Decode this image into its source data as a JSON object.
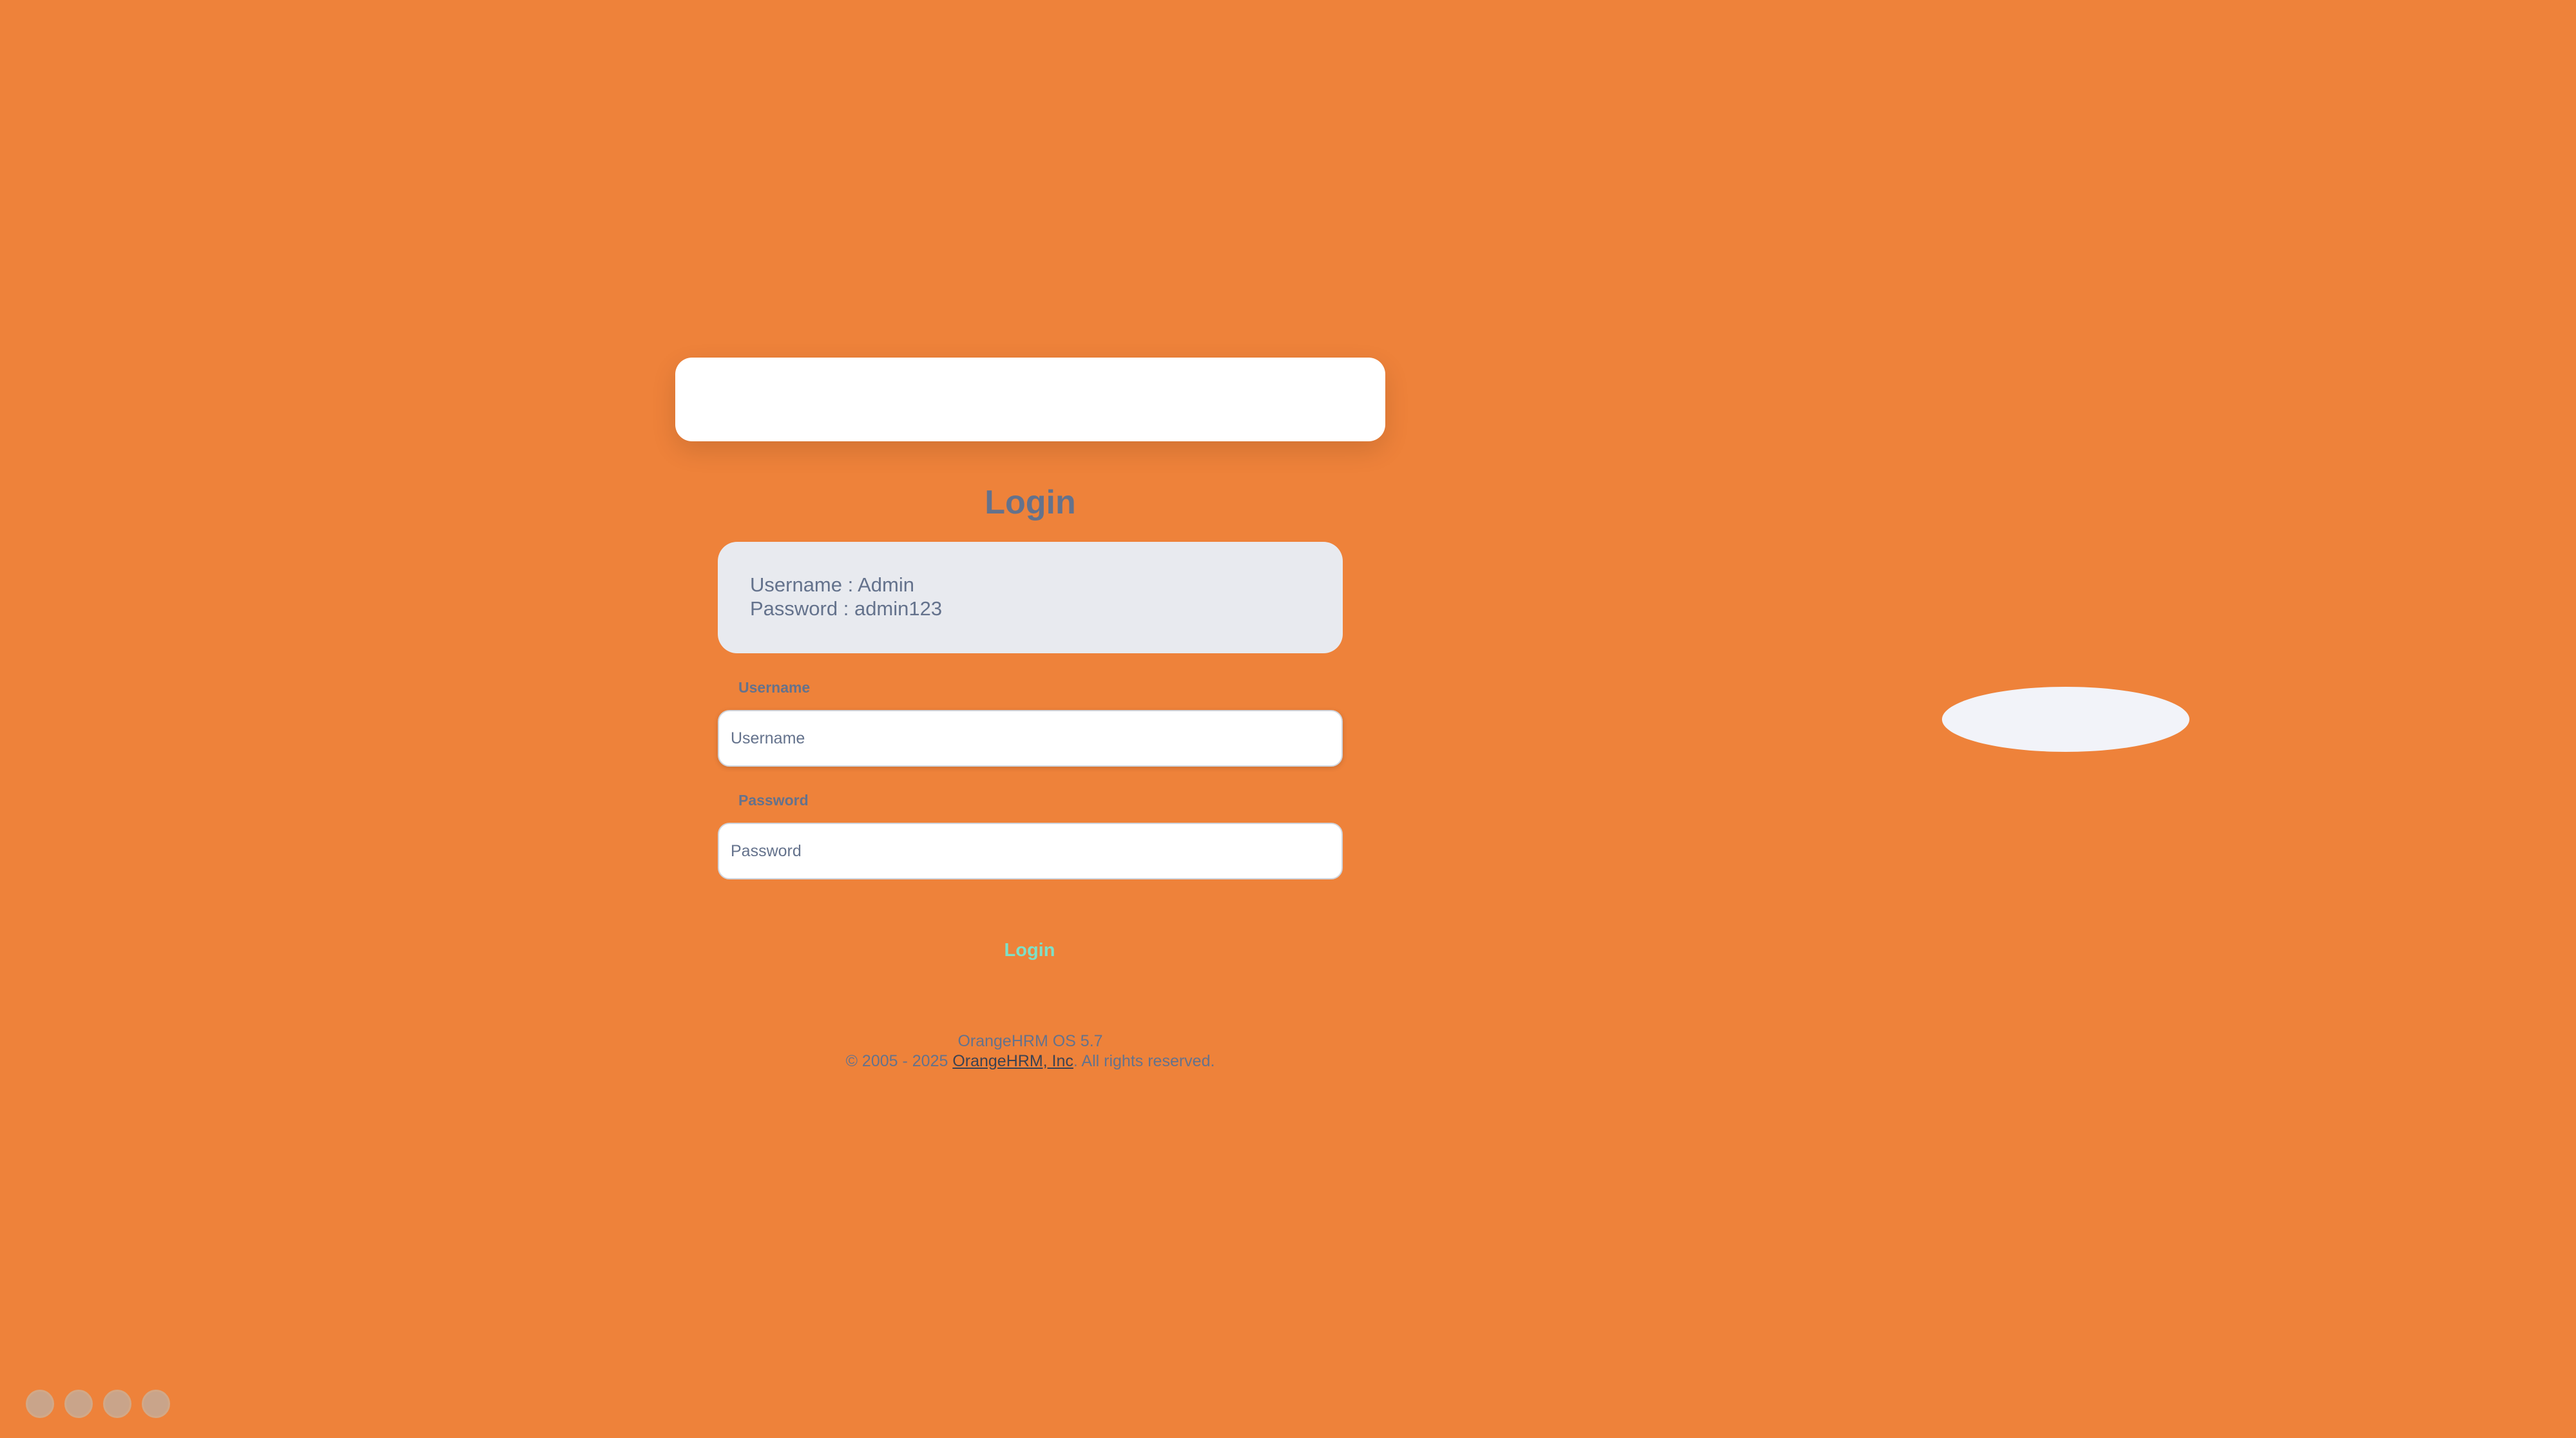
{
  "login": {
    "title": "Login",
    "credentials": {
      "username_line": "Username : Admin",
      "password_line": "Password : admin123"
    },
    "username_label": "Username",
    "username_placeholder": "Username",
    "username_value": "",
    "password_label": "Password",
    "password_placeholder": "Password",
    "password_value": "",
    "submit_label": "Login"
  },
  "footer": {
    "version": "OrangeHRM OS 5.7",
    "copyright_prefix": "© 2005 - 2025 ",
    "company_link": "OrangeHRM, Inc",
    "copyright_suffix": ". All rights reserved."
  },
  "social": [
    "linkedin-icon",
    "facebook-icon",
    "twitter-icon",
    "youtube-icon"
  ],
  "colors": {
    "background": "#ee823a",
    "text": "#64728c",
    "button_text": "#7ee0c6",
    "credentials_bg": "#e8eaef"
  }
}
